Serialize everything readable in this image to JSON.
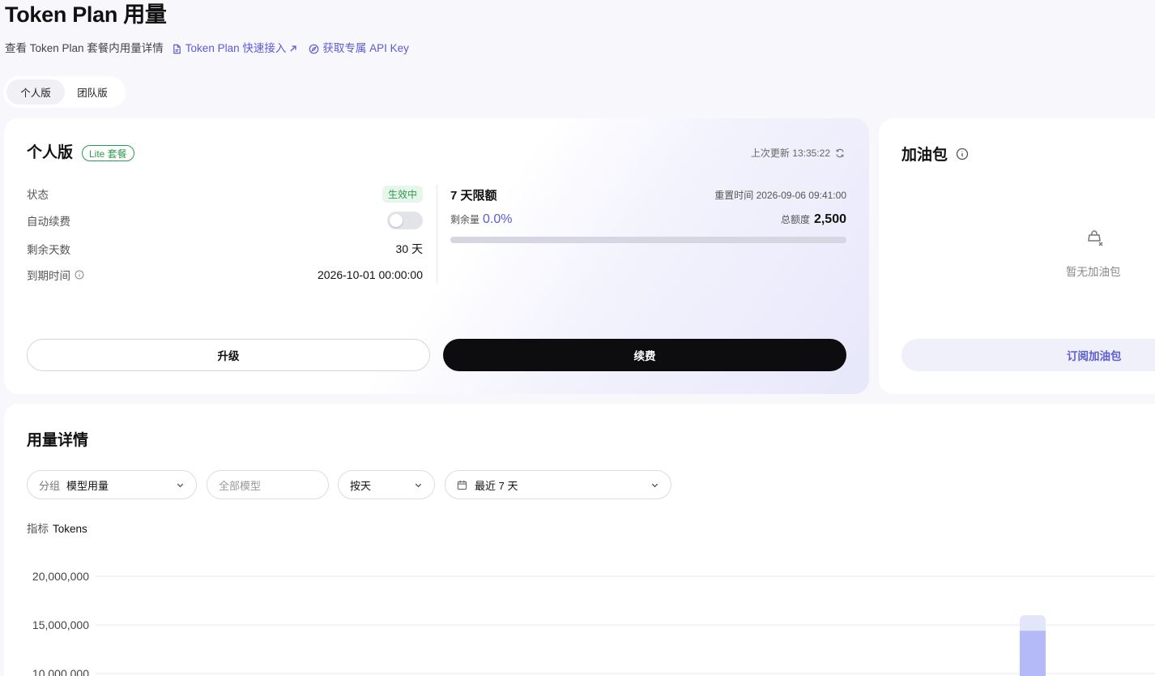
{
  "header": {
    "title": "Token Plan 用量",
    "subtitle": "查看 Token Plan 套餐内用量详情",
    "quick_link": "Token Plan 快速接入",
    "api_key_link": "获取专属 API Key"
  },
  "tabs": [
    {
      "label": "个人版",
      "active": true
    },
    {
      "label": "团队版",
      "active": false
    }
  ],
  "plan_card": {
    "title": "个人版",
    "badge": "Lite 套餐",
    "last_updated_label": "上次更新",
    "last_updated_time": "13:35:22",
    "rows": {
      "status_label": "状态",
      "status_value": "生效中",
      "auto_renew_label": "自动续费",
      "auto_renew_on": false,
      "days_left_label": "剩余天数",
      "days_left_value": "30 天",
      "expire_label": "到期时间",
      "expire_value": "2026-10-01 00:00:00"
    },
    "quota": {
      "title": "7 天限额",
      "reset_label": "重置时间",
      "reset_time": "2026-09-06 09:41:00",
      "remaining_label": "剩余量",
      "remaining_pct": "0.0%",
      "remaining_fraction": 0.0,
      "total_label": "总额度",
      "total_value": "2,500"
    },
    "upgrade_button": "升级",
    "renew_button": "续费"
  },
  "addon_card": {
    "title": "加油包",
    "empty_text": "暂无加油包",
    "subscribe_button": "订阅加油包"
  },
  "usage": {
    "title": "用量详情",
    "filters": {
      "group_label": "分组",
      "group_value": "模型用量",
      "model_placeholder": "全部模型",
      "granularity_value": "按天",
      "range_value": "最近 7 天"
    },
    "metric_label": "指标",
    "metric_value": "Tokens"
  },
  "colors": {
    "accent": "#5b5bd6",
    "success": "#2e9b4e",
    "dark_button": "#0d0d10",
    "bar_light": "#e3e6fb",
    "bar_dark": "#b4baf8"
  },
  "chart_data": {
    "type": "bar",
    "ylabel_ticks": [
      "20,000,000",
      "15,000,000",
      "10,000,000"
    ],
    "y_ticks": [
      20000000,
      15000000,
      10000000
    ],
    "visible_bar": {
      "stack_total": 16000000,
      "dark_segment": 14400000
    }
  }
}
